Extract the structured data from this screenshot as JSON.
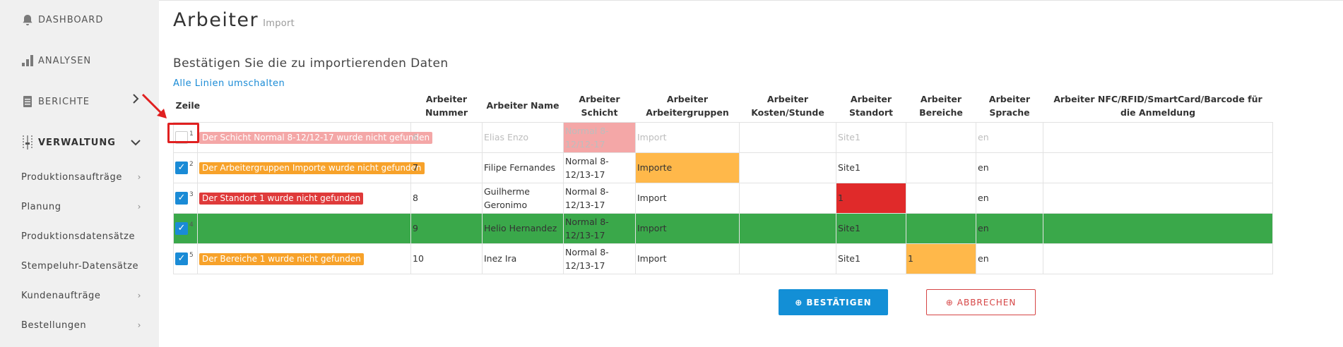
{
  "sidebar": {
    "main_items": [
      {
        "label": "DASHBOARD",
        "icon": "bell-icon"
      },
      {
        "label": "ANALYSEN",
        "icon": "bar-chart-icon"
      },
      {
        "label": "BERICHTE",
        "icon": "document-icon"
      },
      {
        "label": "VERWALTUNG",
        "icon": "sliders-icon"
      }
    ],
    "sub_items": [
      {
        "label": "Produktionsaufträge"
      },
      {
        "label": "Planung"
      },
      {
        "label": "Produktionsdatensätze"
      },
      {
        "label": "Stempeluhr-Datensätze"
      },
      {
        "label": "Kundenaufträge"
      },
      {
        "label": "Bestellungen"
      }
    ]
  },
  "header": {
    "title": "Arbeiter",
    "subtitle": "Import"
  },
  "content": {
    "heading": "Bestätigen Sie die zu importierenden Daten",
    "toggle_all": "Alle Linien umschalten"
  },
  "table": {
    "columns": [
      "Zeile",
      "Arbeiter Nummer",
      "Arbeiter Name",
      "Arbeiter Schicht",
      "Arbeiter Arbeitergruppen",
      "Arbeiter Kosten/Stunde",
      "Arbeiter Standort",
      "Arbeiter Bereiche",
      "Arbeiter Sprache",
      "Arbeiter NFC/RFID/SmartCard/Barcode für die Anmeldung"
    ],
    "rows": [
      {
        "num": "1",
        "error": "Der Schicht Normal 8-12/12-17 wurde nicht gefunden",
        "nummer": "6",
        "name": "Elias Enzo",
        "schicht": "Normal 8-12/12-17",
        "gruppen": "Import",
        "kosten": "",
        "standort": "Site1",
        "bereiche": "",
        "sprache": "en",
        "nfc": ""
      },
      {
        "num": "2",
        "error": "Der Arbeitergruppen Importe wurde nicht gefunden",
        "nummer": "7",
        "name": "Filipe Fernandes",
        "schicht": "Normal 8-12/13-17",
        "gruppen": "Importe",
        "kosten": "",
        "standort": "Site1",
        "bereiche": "",
        "sprache": "en",
        "nfc": ""
      },
      {
        "num": "3",
        "error": "Der Standort 1 wurde nicht gefunden",
        "nummer": "8",
        "name": "Guilherme Geronimo",
        "schicht": "Normal 8-12/13-17",
        "gruppen": "Import",
        "kosten": "",
        "standort": "1",
        "bereiche": "",
        "sprache": "en",
        "nfc": ""
      },
      {
        "num": "4",
        "error": "",
        "nummer": "9",
        "name": "Helio Hernandez",
        "schicht": "Normal 8-12/13-17",
        "gruppen": "Import",
        "kosten": "",
        "standort": "Site1",
        "bereiche": "",
        "sprache": "en",
        "nfc": ""
      },
      {
        "num": "5",
        "error": "Der Bereiche 1 wurde nicht gefunden",
        "nummer": "10",
        "name": "Inez Ira",
        "schicht": "Normal 8-12/13-17",
        "gruppen": "Import",
        "kosten": "",
        "standort": "Site1",
        "bereiche": "1",
        "sprache": "en",
        "nfc": ""
      }
    ]
  },
  "actions": {
    "confirm_label": "BESTÄTIGEN",
    "cancel_label": "ABBRECHEN"
  },
  "colors": {
    "accent": "#138fd6",
    "success_row": "#3aa84a",
    "warning": "#ffb84a",
    "error": "#e02a2a",
    "error_faded": "#f4a7a7"
  }
}
